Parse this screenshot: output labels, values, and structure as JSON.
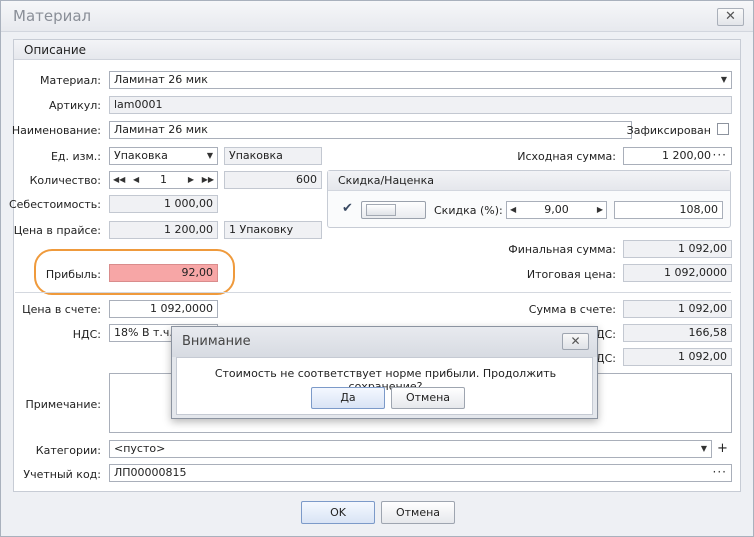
{
  "window": {
    "title": "Материал",
    "close_glyph": "✕"
  },
  "group": {
    "title": "Описание"
  },
  "fields": {
    "material": {
      "label": "Материал:",
      "value": "Ламинат 26 мик"
    },
    "article": {
      "label": "Артикул:",
      "value": "lam0001"
    },
    "name": {
      "label": "Наименование:",
      "value": "Ламинат 26 мик"
    },
    "fixed": {
      "label": "Зафиксирован"
    },
    "unit": {
      "label": "Ед. изм.:",
      "value": "Упаковка",
      "secondary": "Упаковка"
    },
    "source_sum": {
      "label": "Исходная сумма:",
      "value": "1 200,00"
    },
    "quantity": {
      "label": "Количество:",
      "value": "1",
      "secondary": "600"
    },
    "cost": {
      "label": "Себестоимость:",
      "value": "1 000,00"
    },
    "price_list": {
      "label": "Цена в прайсе:",
      "value": "1 200,00",
      "secondary": "1 Упаковку"
    },
    "final_sum": {
      "label": "Финальная сумма:",
      "value": "1 092,00"
    },
    "profit": {
      "label": "Прибыль:",
      "value": "92,00"
    },
    "total_price": {
      "label": "Итоговая цена:",
      "value": "1 092,0000"
    },
    "invoice_price": {
      "label": "Цена в счете:",
      "value": "1 092,0000"
    },
    "invoice_sum": {
      "label": "Сумма в счете:",
      "value": "1 092,00"
    },
    "vat": {
      "label": "НДС:",
      "value": "18% В т.ч."
    },
    "vat_sum": {
      "label_partial": "ДС:",
      "value": "166,58"
    },
    "row3_sum": {
      "label_partial": "ДС:",
      "value": "1 092,00"
    },
    "note": {
      "label": "Примечание:",
      "value": ""
    },
    "categories": {
      "label": "Категории:",
      "value": "<пусто>"
    },
    "account_code": {
      "label": "Учетный код:",
      "value": "ЛП00000815"
    }
  },
  "discount": {
    "title": "Скидка/Наценка",
    "checked": true,
    "discount_label": "Скидка (%):",
    "discount_value": "9,00",
    "discount_amount": "108,00"
  },
  "buttons": {
    "ok": "OK",
    "cancel": "Отмена"
  },
  "dialog": {
    "title": "Внимание",
    "message": "Стоимость не соответствует норме прибыли. Продолжить сохранение?",
    "yes": "Да",
    "no": "Отмена",
    "close_glyph": "✕"
  },
  "glyphs": {
    "dropdown": "▼",
    "dots": "···",
    "plus": "+",
    "first": "◀◀",
    "prev": "◀",
    "next": "▶",
    "last": "▶▶",
    "check": "✔"
  },
  "colors": {
    "profit_bg": "#f7a6a6",
    "highlight_ring": "#ef9a3c"
  }
}
